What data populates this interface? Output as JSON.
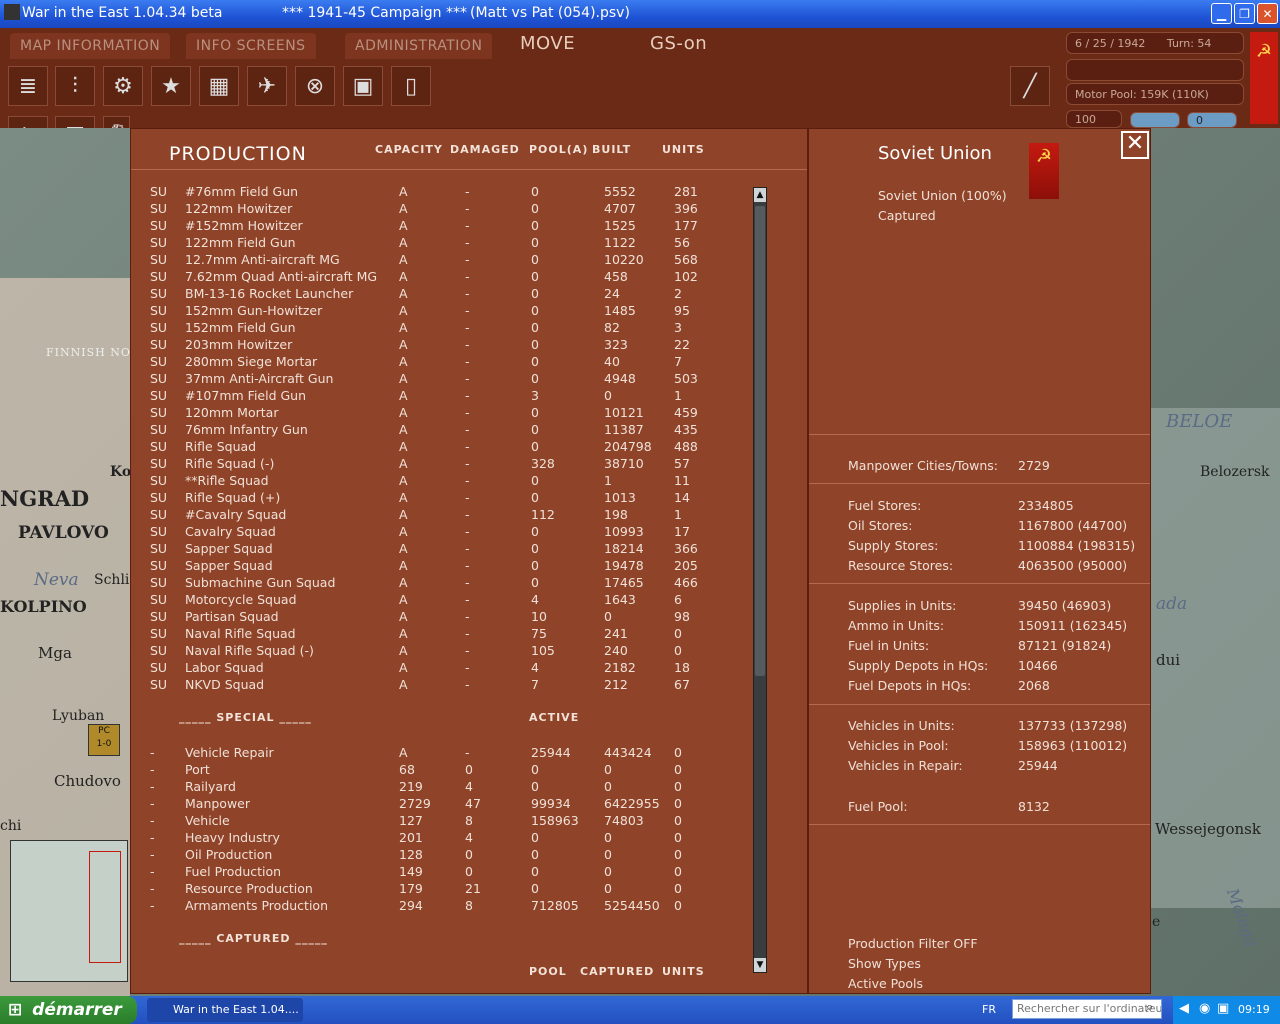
{
  "window": {
    "app_title": "War in the East 1.04.34 beta",
    "campaign_title": "***   1941-45 Campaign   ***",
    "save_title": "(Matt vs Pat (054).psv)"
  },
  "menu": {
    "map_information": "MAP INFORMATION",
    "info_screens": "INFO SCREENS",
    "administration": "ADMINISTRATION",
    "move": "MOVE",
    "gs": "GS-on"
  },
  "status": {
    "date": "6 / 25 / 1942",
    "turn": "Turn: 54",
    "motor_pool": "Motor Pool:  159K (110K)",
    "value_100": "100",
    "value_0": "0"
  },
  "map_labels": {
    "finnish": "FINNISH NO",
    "ngrad": "NGRAD",
    "pavlovo": "PAVLOVO",
    "neva": "Neva",
    "schl": "Schli",
    "kolpino": "KOLPINO",
    "mga": "Mga",
    "lyuban": "Lyuban",
    "chudovo": "Chudovo",
    "chi": "chi",
    "ko": "Ko",
    "beloe": "BELOE",
    "belozersk": "Belozersk",
    "ada": "ada",
    "dui": "dui",
    "wessejegonsk": "Wessejegonsk",
    "mologa": "Mologa",
    "e": "e",
    "pc": "PC",
    "pc_val": "1-0"
  },
  "production": {
    "title": "PRODUCTION",
    "headers": {
      "capacity": "CAPACITY",
      "damaged": "DAMAGED",
      "pool": "POOL(A)",
      "built": "BUILT",
      "units": "UNITS"
    },
    "rows": [
      [
        "SU",
        "#76mm Field Gun",
        "A",
        "-",
        "0",
        "5552",
        "281"
      ],
      [
        "SU",
        "122mm Howitzer",
        "A",
        "-",
        "0",
        "4707",
        "396"
      ],
      [
        "SU",
        "#152mm Howitzer",
        "A",
        "-",
        "0",
        "1525",
        "177"
      ],
      [
        "SU",
        "122mm Field Gun",
        "A",
        "-",
        "0",
        "1122",
        "56"
      ],
      [
        "SU",
        "12.7mm Anti-aircraft MG",
        "A",
        "-",
        "0",
        "10220",
        "568"
      ],
      [
        "SU",
        "7.62mm Quad Anti-aircraft MG",
        "A",
        "-",
        "0",
        "458",
        "102"
      ],
      [
        "SU",
        "BM-13-16 Rocket Launcher",
        "A",
        "-",
        "0",
        "24",
        "2"
      ],
      [
        "SU",
        "152mm Gun-Howitzer",
        "A",
        "-",
        "0",
        "1485",
        "95"
      ],
      [
        "SU",
        "152mm Field Gun",
        "A",
        "-",
        "0",
        "82",
        "3"
      ],
      [
        "SU",
        "203mm Howitzer",
        "A",
        "-",
        "0",
        "323",
        "22"
      ],
      [
        "SU",
        "280mm Siege Mortar",
        "A",
        "-",
        "0",
        "40",
        "7"
      ],
      [
        "SU",
        "37mm Anti-Aircraft Gun",
        "A",
        "-",
        "0",
        "4948",
        "503"
      ],
      [
        "SU",
        "#107mm Field Gun",
        "A",
        "-",
        "3",
        "0",
        "1"
      ],
      [
        "SU",
        "120mm Mortar",
        "A",
        "-",
        "0",
        "10121",
        "459"
      ],
      [
        "SU",
        "76mm Infantry Gun",
        "A",
        "-",
        "0",
        "11387",
        "435"
      ],
      [
        "SU",
        "Rifle Squad",
        "A",
        "-",
        "0",
        "204798",
        "488"
      ],
      [
        "SU",
        "Rifle Squad (-)",
        "A",
        "-",
        "328",
        "38710",
        "57"
      ],
      [
        "SU",
        "**Rifle Squad",
        "A",
        "-",
        "0",
        "1",
        "11"
      ],
      [
        "SU",
        "Rifle Squad (+)",
        "A",
        "-",
        "0",
        "1013",
        "14"
      ],
      [
        "SU",
        "#Cavalry Squad",
        "A",
        "-",
        "112",
        "198",
        "1"
      ],
      [
        "SU",
        "Cavalry Squad",
        "A",
        "-",
        "0",
        "10993",
        "17"
      ],
      [
        "SU",
        "Sapper Squad",
        "A",
        "-",
        "0",
        "18214",
        "366"
      ],
      [
        "SU",
        "Sapper Squad",
        "A",
        "-",
        "0",
        "19478",
        "205"
      ],
      [
        "SU",
        "Submachine Gun Squad",
        "A",
        "-",
        "0",
        "17465",
        "466"
      ],
      [
        "SU",
        "Motorcycle Squad",
        "A",
        "-",
        "4",
        "1643",
        "6"
      ],
      [
        "SU",
        "Partisan Squad",
        "A",
        "-",
        "10",
        "0",
        "98"
      ],
      [
        "SU",
        "Naval Rifle Squad",
        "A",
        "-",
        "75",
        "241",
        "0"
      ],
      [
        "SU",
        "Naval Rifle Squad (-)",
        "A",
        "-",
        "105",
        "240",
        "0"
      ],
      [
        "SU",
        "Labor Squad",
        "A",
        "-",
        "4",
        "2182",
        "18"
      ],
      [
        "SU",
        "NKVD Squad",
        "A",
        "-",
        "7",
        "212",
        "67"
      ]
    ],
    "special_header": "_____ SPECIAL _____",
    "active_header": "ACTIVE",
    "special_rows": [
      [
        "-",
        "Vehicle Repair",
        "A",
        "-",
        "25944",
        "443424",
        "0"
      ],
      [
        "-",
        "Port",
        "68",
        "0",
        "0",
        "0",
        "0"
      ],
      [
        "-",
        "Railyard",
        "219",
        "4",
        "0",
        "0",
        "0"
      ],
      [
        "-",
        "Manpower",
        "2729",
        "47",
        "99934",
        "6422955",
        "0"
      ],
      [
        "-",
        "Vehicle",
        "127",
        "8",
        "158963",
        "74803",
        "0"
      ],
      [
        "-",
        "Heavy Industry",
        "201",
        "4",
        "0",
        "0",
        "0"
      ],
      [
        "-",
        "Oil Production",
        "128",
        "0",
        "0",
        "0",
        "0"
      ],
      [
        "-",
        "Fuel Production",
        "149",
        "0",
        "0",
        "0",
        "0"
      ],
      [
        "-",
        "Resource Production",
        "179",
        "21",
        "0",
        "0",
        "0"
      ],
      [
        "-",
        "Armaments Production",
        "294",
        "8",
        "712805",
        "5254450",
        "0"
      ]
    ],
    "captured_header": "_____ CAPTURED _____",
    "captured_cols": {
      "pool": "POOL",
      "captured": "CAPTURED",
      "units": "UNITS"
    }
  },
  "info": {
    "nation": "Soviet Union",
    "ownership": "Soviet Union  (100%)",
    "captured": "Captured",
    "stats1": [
      [
        "Manpower Cities/Towns:",
        "2729"
      ]
    ],
    "stats2": [
      [
        "Fuel Stores:",
        "2334805"
      ],
      [
        "Oil Stores:",
        "1167800 (44700)"
      ],
      [
        "Supply Stores:",
        "1100884 (198315)"
      ],
      [
        "Resource Stores:",
        "4063500 (95000)"
      ]
    ],
    "stats3": [
      [
        "Supplies in Units:",
        "39450 (46903)"
      ],
      [
        "Ammo in Units:",
        "150911 (162345)"
      ],
      [
        "Fuel in Units:",
        "87121 (91824)"
      ],
      [
        "Supply Depots in HQs:",
        "10466"
      ],
      [
        "Fuel Depots in HQs:",
        "2068"
      ]
    ],
    "stats4": [
      [
        "Vehicles in Units:",
        "137733 (137298)"
      ],
      [
        "Vehicles in Pool:",
        "158963 (110012)"
      ],
      [
        "Vehicles in Repair:",
        "25944"
      ]
    ],
    "fuel_pool_label": "Fuel Pool:",
    "fuel_pool_value": "8132",
    "filter": "Production Filter OFF",
    "show_types": "Show Types",
    "active_pools": "Active Pools",
    "close_glyph": "✕"
  },
  "taskbar": {
    "start": "démarrer",
    "task": "War in the East 1.04....",
    "lang": "FR",
    "search_placeholder": "Rechercher sur l'ordinateur",
    "clock": "09:19"
  },
  "colors": {
    "panel": "#8f4328",
    "panel_dark": "#6a2a16",
    "flag_red": "#c41a10"
  }
}
